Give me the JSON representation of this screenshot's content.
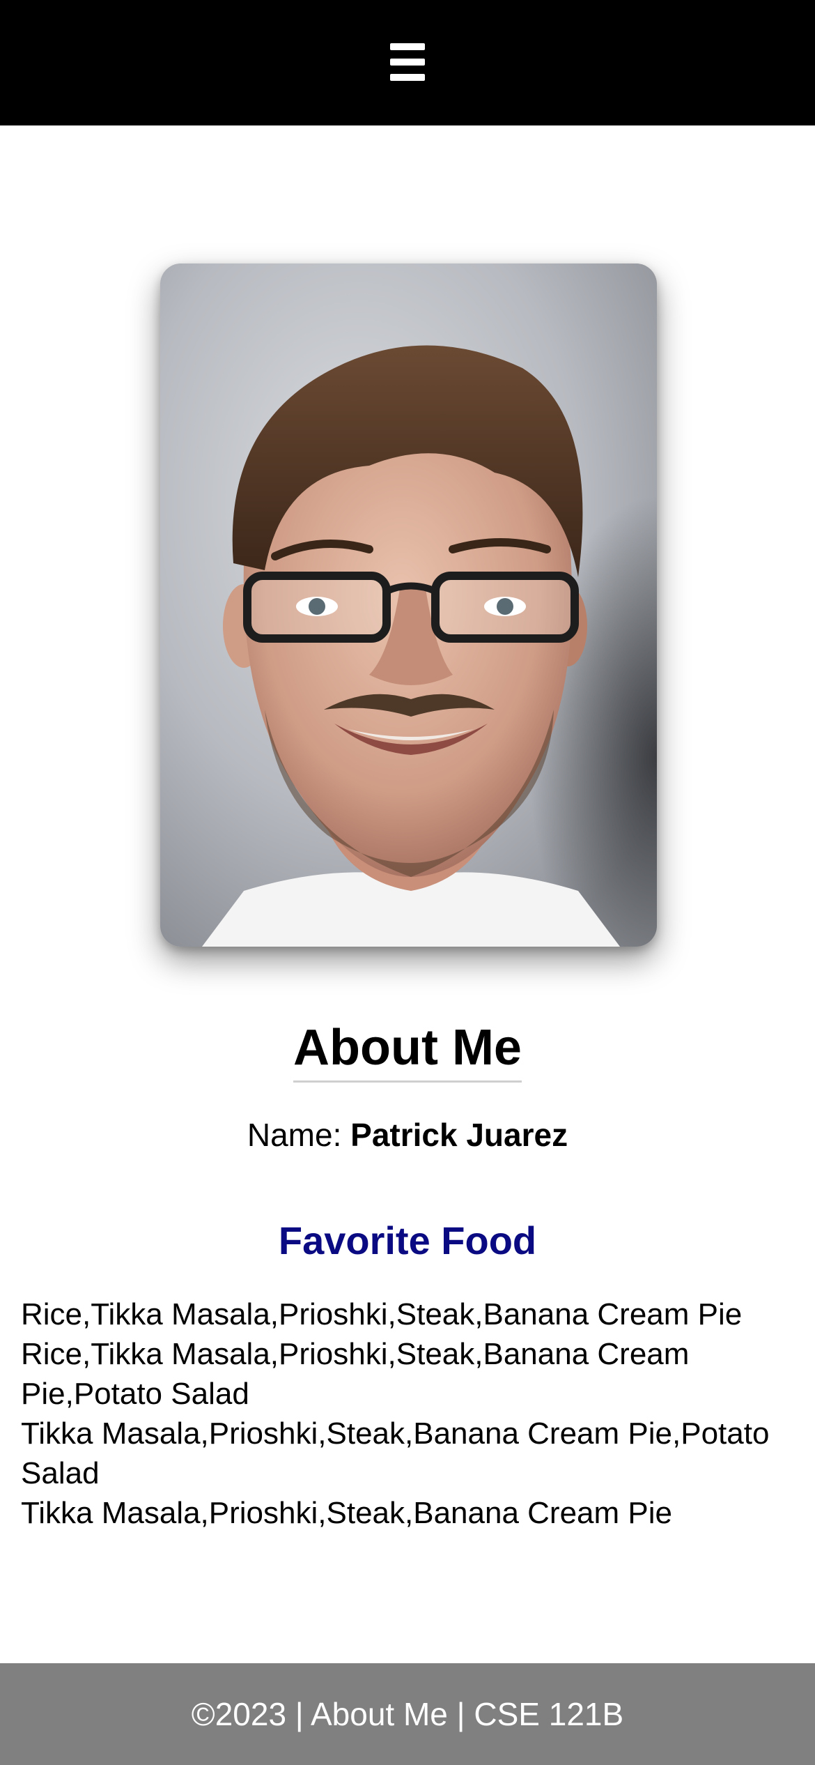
{
  "header": {
    "menu_icon": "hamburger-menu-icon",
    "background": "#000000"
  },
  "portrait": {
    "alt": "Portrait photo"
  },
  "about": {
    "title": "About Me",
    "name_label": "Name:",
    "name_value": "Patrick Juarez"
  },
  "favorite_food": {
    "title": "Favorite Food",
    "title_color": "#0a0a82",
    "lines": [
      "Rice,Tikka Masala,Prioshki,Steak,Banana Cream Pie",
      "Rice,Tikka Masala,Prioshki,Steak,Banana Cream Pie,Potato Salad",
      "Tikka Masala,Prioshki,Steak,Banana Cream Pie,Potato Salad",
      "Tikka Masala,Prioshki,Steak,Banana Cream Pie"
    ]
  },
  "footer": {
    "text": "©2023 | About Me | CSE 121B",
    "background": "#808080"
  }
}
